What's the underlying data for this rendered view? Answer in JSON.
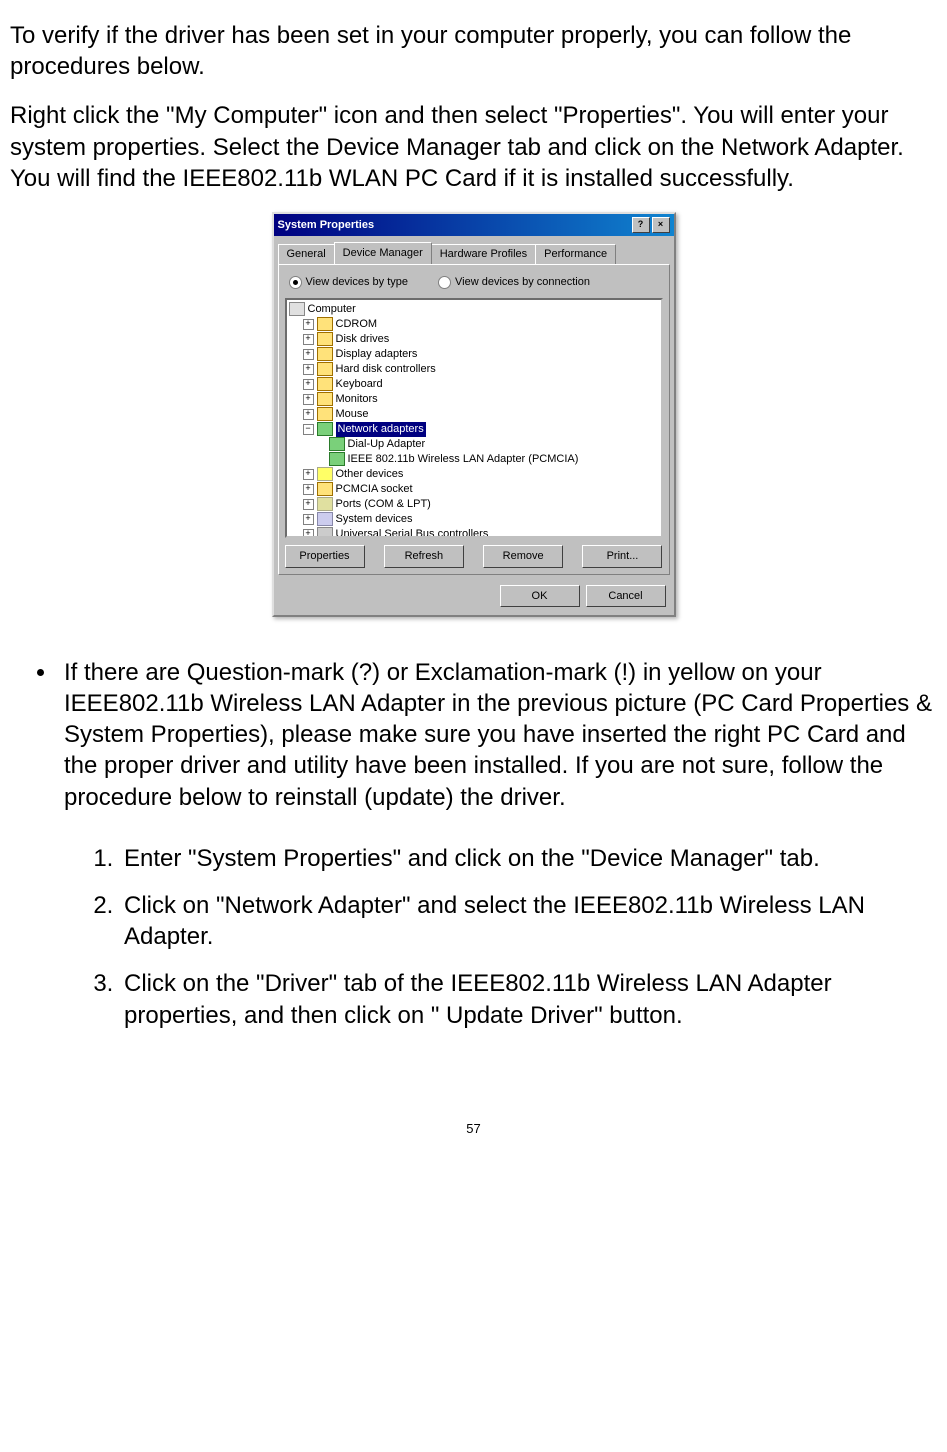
{
  "para1": "To verify if the driver has been set in your computer properly, you can follow the procedures below.",
  "para2": "Right click the \"My Computer\" icon and then select \"Properties\". You will enter your system properties. Select the Device Manager tab and click on the Network Adapter. You will find the IEEE802.11b WLAN PC Card if it is installed successfully.",
  "dialog": {
    "title": "System Properties",
    "tabs": {
      "general": "General",
      "device_manager": "Device Manager",
      "hardware_profiles": "Hardware Profiles",
      "performance": "Performance"
    },
    "radio": {
      "by_type": "View devices by type",
      "by_connection": "View devices by connection"
    },
    "tree": {
      "root": "Computer",
      "items": [
        "CDROM",
        "Disk drives",
        "Display adapters",
        "Hard disk controllers",
        "Keyboard",
        "Monitors",
        "Mouse"
      ],
      "net": {
        "label": "Network adapters",
        "children": [
          "Dial-Up Adapter",
          "IEEE 802.11b Wireless LAN Adapter (PCMCIA)"
        ]
      },
      "rest": [
        "Other devices",
        "PCMCIA socket",
        "Ports (COM & LPT)",
        "System devices",
        "Universal Serial Bus controllers"
      ]
    },
    "buttons": {
      "properties": "Properties",
      "refresh": "Refresh",
      "remove": "Remove",
      "print": "Print...",
      "ok": "OK",
      "cancel": "Cancel"
    }
  },
  "bullet1": "If there are Question-mark (?) or Exclamation-mark (!) in yellow on your IEEE802.11b Wireless LAN Adapter in the previous picture (PC Card Properties & System Properties), please make sure you have inserted the right PC Card and the proper driver and utility have been installed. If you are not sure, follow the procedure below to reinstall (update) the driver.",
  "steps": [
    "Enter \"System Properties\" and click on the \"Device Manager\" tab.",
    "Click on \"Network Adapter\" and select the IEEE802.11b Wireless LAN Adapter.",
    "Click on the \"Driver\" tab of the IEEE802.11b Wireless LAN Adapter properties, and then click on \" Update Driver\" button."
  ],
  "page_number": "57"
}
